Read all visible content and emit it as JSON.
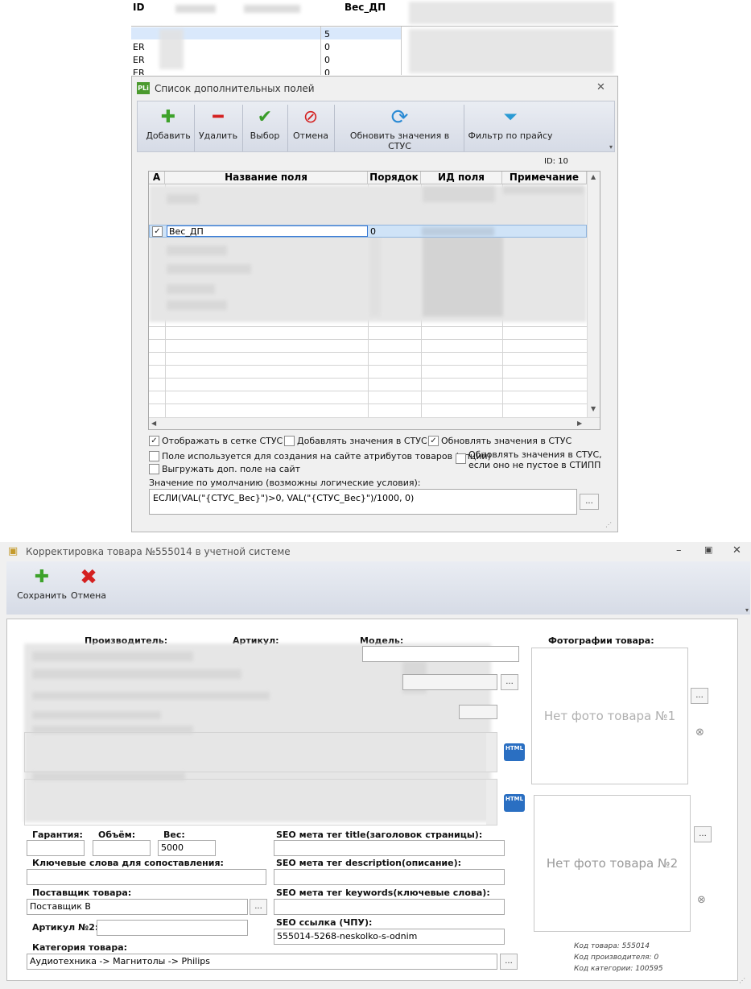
{
  "bg_grid": {
    "col_id": "ID",
    "col_weight": "Вес_ДП",
    "rows": [
      {
        "id": "",
        "weight": "5"
      },
      {
        "id": "ER",
        "weight": "0"
      },
      {
        "id": "ER",
        "weight": "0"
      },
      {
        "id": "ER",
        "weight": "0"
      }
    ]
  },
  "dialog": {
    "title": "Список дополнительных полей",
    "app_icon": "PLi",
    "close_icon": "close-icon",
    "toolbar": {
      "add": "Добавить",
      "delete": "Удалить",
      "select": "Выбор",
      "cancel": "Отмена",
      "update": "Обновить значения в СТУС",
      "filter": "Фильтр по прайсу"
    },
    "id_label": "ID: 10",
    "columns": {
      "a": "A",
      "name": "Название поля",
      "order": "Порядок",
      "field_id": "ИД поля",
      "note": "Примечание"
    },
    "selected_row": {
      "checked": "✓",
      "name": "Вес_ДП",
      "order": "0"
    },
    "options": {
      "show_in_grid": "Отображать в сетке СТУС",
      "add_values": "Добавлять значения в СТУС",
      "update_values": "Обновлять значения в СТУС",
      "used_for_attributes": "Поле используется для создания на сайте атрибутов товаров (опций)",
      "update_if_not_empty_1": "Обновлять значения в СТУС,",
      "update_if_not_empty_2": "если оно не пустое в СТИПП",
      "export_to_site": "Выгружать доп. поле на сайт"
    },
    "default_value_label": "Значение по умолчанию (возможны логические условия):",
    "default_value": "ЕСЛИ(VAL(\"{СТУС_Вес}\")>0, VAL(\"{СТУС_Вес}\")/1000, 0)",
    "ellipsis": "..."
  },
  "form": {
    "title": "Корректировка товара №555014 в учетной системе",
    "toolbar": {
      "save": "Сохранить",
      "cancel": "Отмена"
    },
    "labels": {
      "manufacturer": "Производитель:",
      "article": "Артикул:",
      "model": "Модель:",
      "photos": "Фотографии товара:",
      "warranty": "Гарантия:",
      "volume": "Объём:",
      "weight": "Вес:",
      "keywords": "Ключевые слова для сопоставления:",
      "supplier": "Поставщик товара:",
      "article2": "Артикул №2:",
      "category": "Категория товара:",
      "seo_title": "SEO мета тег title(заголовок страницы):",
      "seo_description": "SEO мета тег description(описание):",
      "seo_keywords": "SEO мета тег keywords(ключевые слова):",
      "seo_url": "SEO ссылка (ЧПУ):"
    },
    "values": {
      "weight": "5000",
      "supplier": "Поставщик В",
      "category": "Аудиотехника -> Магнитолы -> Philips",
      "seo_url": "555014-5268-neskolko-s-odnim"
    },
    "photo1": "Нет фото товара №1",
    "photo2": "Нет фото товара №2",
    "html_label": "HTML",
    "info": {
      "product_code": "Код товара: 555014",
      "manufacturer_code": "Код производителя: 0",
      "category_code": "Код категории: 100595"
    },
    "ellipsis": "..."
  }
}
